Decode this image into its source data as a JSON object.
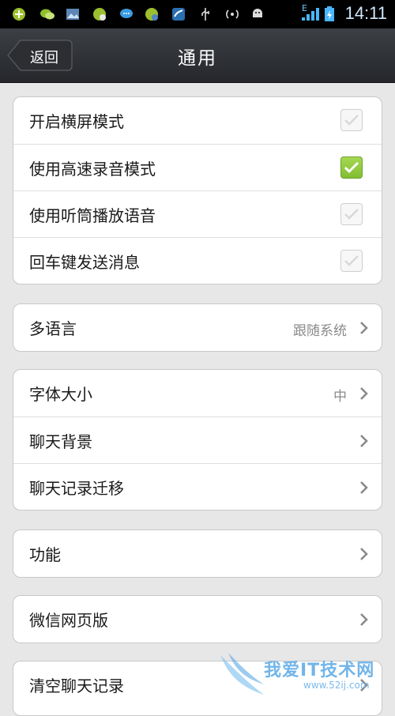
{
  "statusbar": {
    "time": "14:11",
    "icons": [
      "app-icon",
      "chat-icon",
      "gallery-icon",
      "game-icon",
      "message-icon",
      "game-icon",
      "app-icon",
      "usb-icon",
      "hotspot-icon",
      "android-icon"
    ],
    "network_label": "E"
  },
  "header": {
    "back_label": "返回",
    "title": "通用"
  },
  "groups": {
    "toggles": [
      {
        "label": "开启横屏模式",
        "checked": false
      },
      {
        "label": "使用高速录音模式",
        "checked": true
      },
      {
        "label": "使用听筒播放语音",
        "checked": false
      },
      {
        "label": "回车键发送消息",
        "checked": false
      }
    ],
    "language": {
      "label": "多语言",
      "value": "跟随系统"
    },
    "display": [
      {
        "label": "字体大小",
        "value": "中"
      },
      {
        "label": "聊天背景",
        "value": ""
      },
      {
        "label": "聊天记录迁移",
        "value": ""
      }
    ],
    "features": {
      "label": "功能"
    },
    "web": {
      "label": "微信网页版"
    },
    "clear": {
      "label": "清空聊天记录"
    }
  },
  "watermark": {
    "text": "我爱IT技术网",
    "sub": "www.52ij.com"
  },
  "colors": {
    "check_on": "#8cc63f",
    "title_bg": "#2f3236",
    "page_bg": "#e7e7e7"
  }
}
